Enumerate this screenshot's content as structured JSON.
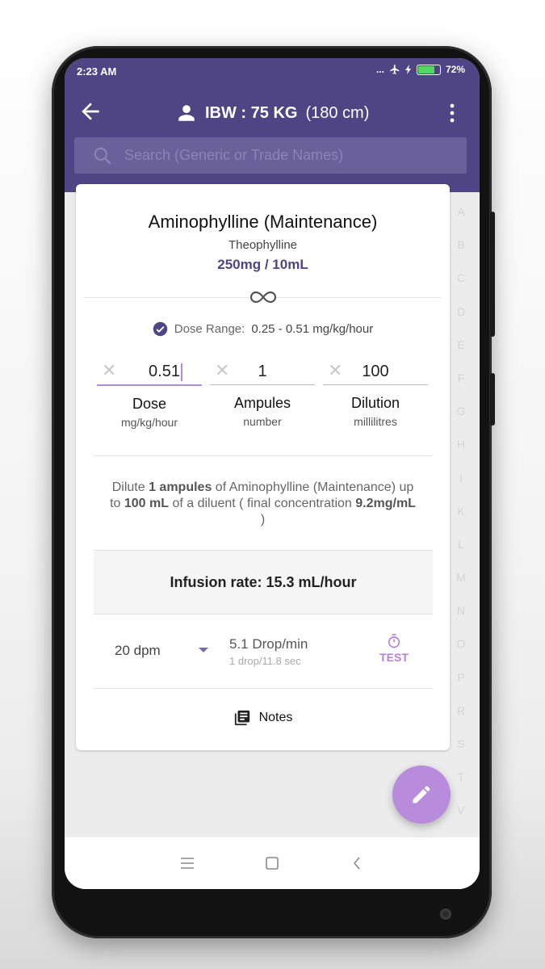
{
  "status_bar": {
    "time": "2:23 AM",
    "dots": "...",
    "battery": "72%",
    "battery_level": 0.72
  },
  "app_bar": {
    "title_bold": "IBW : 75 KG",
    "title_light": "(180 cm)",
    "search_placeholder": "Search (Generic or Trade Names)"
  },
  "alphabet": [
    "A",
    "B",
    "C",
    "D",
    "E",
    "F",
    "G",
    "H",
    "I",
    "K",
    "L",
    "M",
    "N",
    "O",
    "P",
    "R",
    "S",
    "T",
    "V"
  ],
  "drug": {
    "name": "Aminophylline (Maintenance)",
    "generic": "Theophylline",
    "strength": "250mg / 10mL",
    "dose_range_label": "Dose Range:",
    "dose_range_value": "0.25 - 0.51 mg/kg/hour"
  },
  "inputs": {
    "dose": {
      "value": "0.51",
      "label": "Dose",
      "unit": "mg/kg/hour"
    },
    "ampules": {
      "value": "1",
      "label": "Ampules",
      "unit": "number"
    },
    "dilution": {
      "value": "100",
      "label": "Dilution",
      "unit": "millilitres"
    }
  },
  "instruction": {
    "p1": "Dilute ",
    "ampules": "1 ampules",
    "p2": " of Aminophylline (Maintenance) up to ",
    "volume": "100 mL",
    "p3": " of a diluent ( final concentration ",
    "concentration": "9.2mg/mL",
    "p4": " )"
  },
  "infusion_rate": "Infusion rate: 15.3 mL/hour",
  "drip": {
    "set": "20 dpm",
    "drops_per_min": "5.1 Drop/min",
    "interval": "1 drop/11.8 sec",
    "test_label": "TEST"
  },
  "notes_label": "Notes",
  "colors": {
    "primary": "#4f4584",
    "accent": "#b98bdc"
  }
}
